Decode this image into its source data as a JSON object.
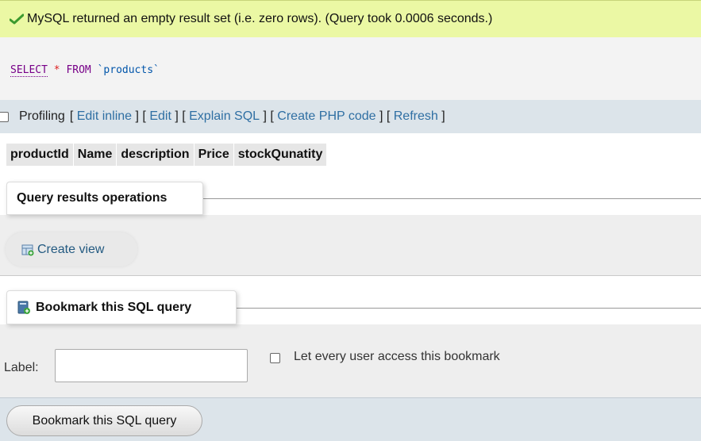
{
  "success": {
    "icon": "checkmark-icon",
    "message": "MySQL returned an empty result set (i.e. zero rows). (Query took 0.0006 seconds.)",
    "color": "#ebf8a4"
  },
  "sql": {
    "select": "SELECT",
    "star": "*",
    "from": "FROM",
    "table": "`products`"
  },
  "profiling": {
    "label": "Profiling",
    "links": [
      "Edit inline",
      "Edit",
      "Explain SQL",
      "Create PHP code",
      "Refresh"
    ]
  },
  "columns": [
    "productId",
    "Name",
    "description",
    "Price",
    "stockQunatity"
  ],
  "operations": {
    "title": "Query results operations",
    "create_view": "Create view"
  },
  "bookmark": {
    "title": "Bookmark this SQL query",
    "label": "Label:",
    "label_value": "",
    "access_text": "Let every user access this bookmark",
    "submit": "Bookmark this SQL query"
  }
}
